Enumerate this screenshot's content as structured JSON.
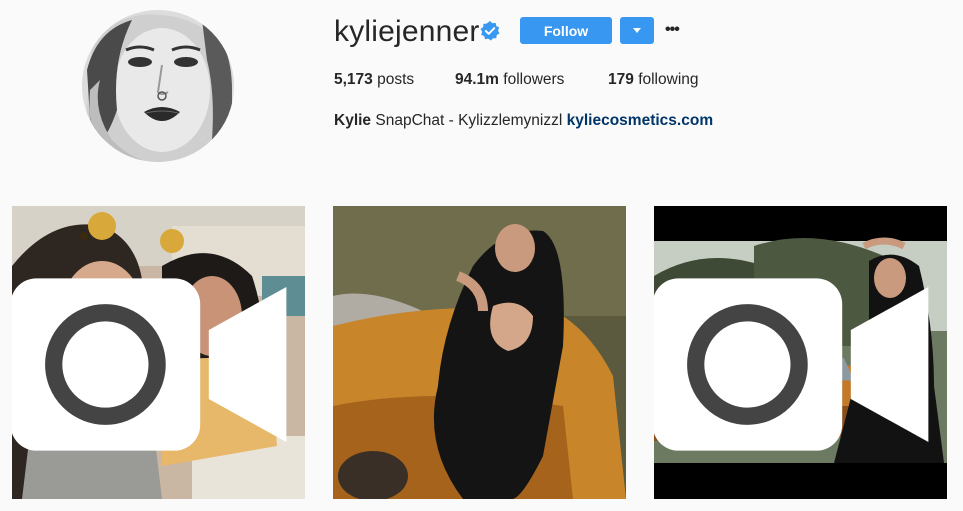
{
  "profile": {
    "username": "kyliejenner",
    "verified": true,
    "follow_label": "Follow",
    "stats": {
      "posts_count": "5,173",
      "posts_label": "posts",
      "followers_count": "94.1m",
      "followers_label": "followers",
      "following_count": "179",
      "following_label": "following"
    },
    "bio": {
      "name": "Kylie",
      "text": "SnapChat - Kylizzlemynizzl",
      "link": "kyliecosmetics.com"
    }
  },
  "posts": [
    {
      "type": "video",
      "icon": "video-icon"
    },
    {
      "type": "photo"
    },
    {
      "type": "video",
      "icon": "video-icon"
    }
  ],
  "colors": {
    "accent": "#3897f0",
    "verified": "#3897f0",
    "link": "#003569",
    "background": "#fafafa"
  }
}
